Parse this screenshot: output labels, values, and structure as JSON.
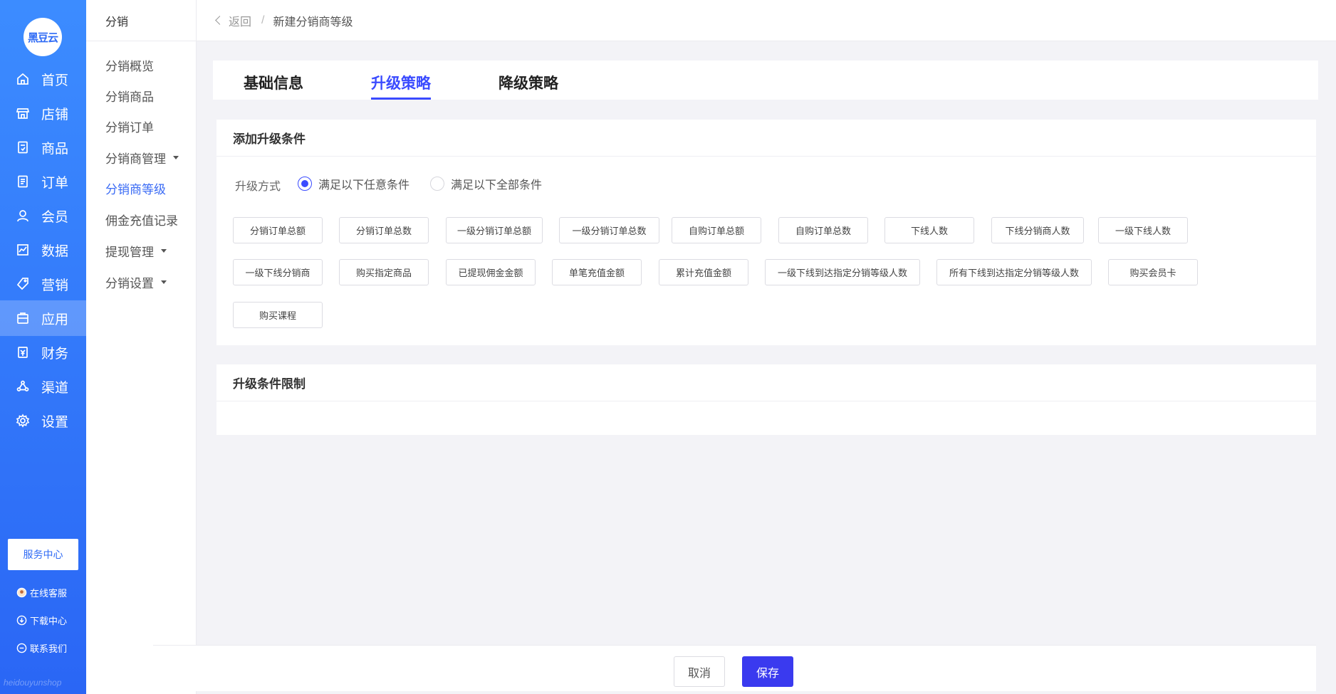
{
  "nav": {
    "logo_text": "黑豆云",
    "items": [
      {
        "label": "首页",
        "icon": "home-icon"
      },
      {
        "label": "店铺",
        "icon": "store-icon"
      },
      {
        "label": "商品",
        "icon": "goods-icon"
      },
      {
        "label": "订单",
        "icon": "order-icon"
      },
      {
        "label": "会员",
        "icon": "member-icon"
      },
      {
        "label": "数据",
        "icon": "data-icon"
      },
      {
        "label": "营销",
        "icon": "tag-icon"
      },
      {
        "label": "应用",
        "icon": "app-icon"
      },
      {
        "label": "财务",
        "icon": "finance-icon"
      },
      {
        "label": "渠道",
        "icon": "channel-icon"
      },
      {
        "label": "设置",
        "icon": "gear-icon"
      }
    ],
    "active_index": 7,
    "service_center": "服务中心",
    "online_service": "在线客服",
    "download_center": "下载中心",
    "contact_us": "联系我们",
    "watermark": "heidouyunshop",
    "accent": "#2f6bf5"
  },
  "subnav": {
    "title": "分销",
    "items": [
      {
        "label": "分销概览",
        "has_caret": false
      },
      {
        "label": "分销商品",
        "has_caret": false
      },
      {
        "label": "分销订单",
        "has_caret": false
      },
      {
        "label": "分销商管理",
        "has_caret": true
      },
      {
        "label": "分销商等级",
        "has_caret": false
      },
      {
        "label": "佣金充值记录",
        "has_caret": false
      },
      {
        "label": "提现管理",
        "has_caret": true
      },
      {
        "label": "分销设置",
        "has_caret": true
      }
    ],
    "active_index": 4
  },
  "header": {
    "back_label": "返回",
    "separator": "/",
    "title": "新建分销商等级"
  },
  "tabs": [
    {
      "label": "基础信息",
      "active": false
    },
    {
      "label": "升级策略",
      "active": true
    },
    {
      "label": "降级策略",
      "active": false
    }
  ],
  "upgrade_conditions": {
    "title": "添加升级条件",
    "mode_label": "升级方式",
    "options": [
      {
        "label": "满足以下任意条件",
        "checked": true
      },
      {
        "label": "满足以下全部条件",
        "checked": false
      }
    ],
    "conditions": [
      "分销订单总额",
      "分销订单总数",
      "一级分销订单总额",
      "一级分销订单总数",
      "自购订单总额",
      "自购订单总数",
      "下线人数",
      "下线分销商人数",
      "一级下线人数",
      "一级下线分销商",
      "购买指定商品",
      "已提现佣金金额",
      "单笔充值金额",
      "累计充值金额",
      "一级下线到达指定分销等级人数",
      "所有下线到达指定分销等级人数",
      "购买会员卡",
      "购买课程"
    ]
  },
  "upgrade_limits": {
    "title": "升级条件限制"
  },
  "footer": {
    "cancel_label": "取消",
    "save_label": "保存",
    "primary_color": "#3a3aef"
  }
}
